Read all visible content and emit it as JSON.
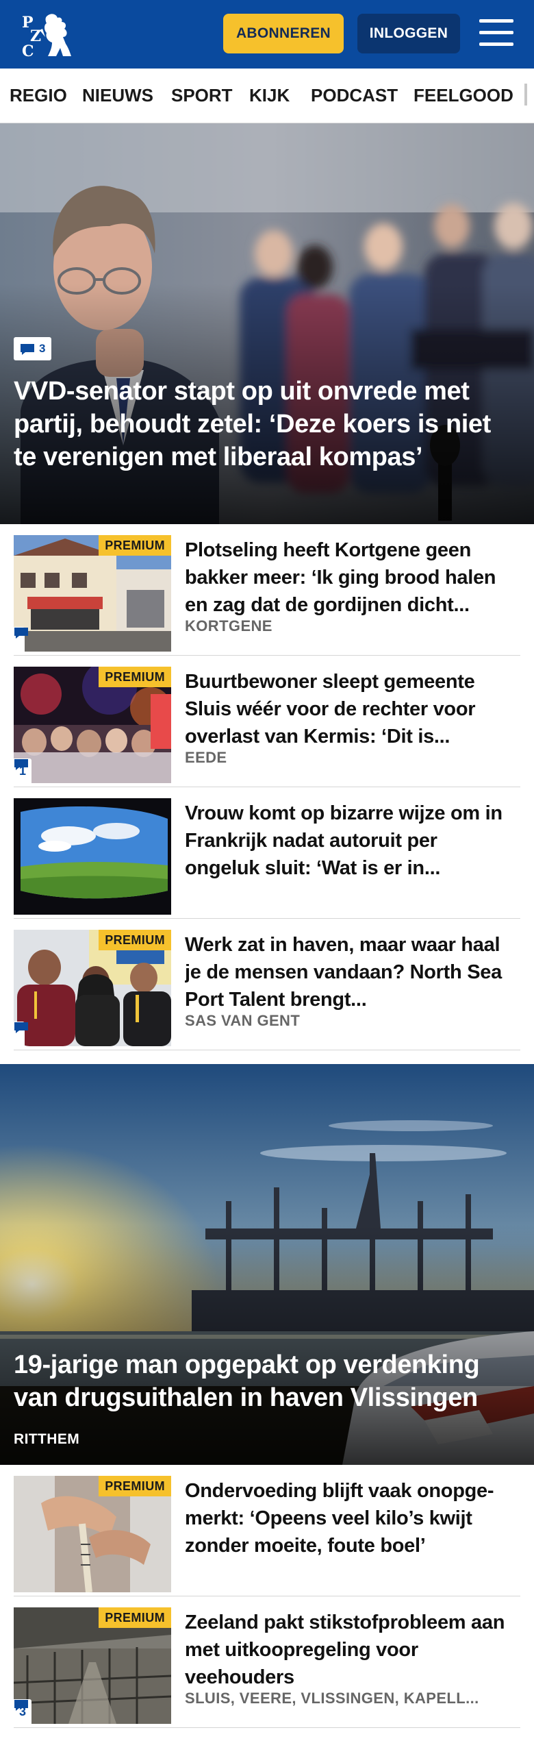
{
  "header": {
    "logo_text": "PZC",
    "subscribe_label": "ABONNEREN",
    "login_label": "INLOGGEN",
    "menu_icon": "hamburger-menu-icon",
    "brand_color": "#0a4a9e",
    "accent_color": "#f6c12c"
  },
  "nav": {
    "items": [
      "REGIO",
      "NIEUWS",
      "SPORT",
      "KIJK",
      "PODCAST",
      "FEELGOOD"
    ]
  },
  "hero1": {
    "comments": "3",
    "title": "VVD-senator stapt op uit onvrede met partij, behoudt zetel: ‘Deze koers is niet te verenigen met liberaal kompas’"
  },
  "articles": [
    {
      "premium": "PREMIUM",
      "title": "Plotseling heeft Kortgene geen bakker meer: ‘Ik ging brood halen en zag dat de gordijnen dicht...",
      "location": "KORTGENE",
      "comments": ""
    },
    {
      "premium": "PREMIUM",
      "title": "Buurtbewoner sleept gemeente Sluis wéér voor de rechter voor overlast van Kermis: ‘Dit is...",
      "location": "EEDE",
      "comments": "1"
    },
    {
      "premium": "",
      "title": "Vrouw komt op bizarre wijze om in Frankrijk nadat autoruit per ongeluk sluit: ‘Wat is er in...",
      "location": "",
      "comments": ""
    },
    {
      "premium": "PREMIUM",
      "title": "Werk zat in haven, maar waar haal je de mensen vandaan? North Sea Port Talent brengt...",
      "location": "SAS VAN GENT",
      "comments": ""
    }
  ],
  "hero2": {
    "title": "19-jarige man opgepakt op verdenking van drugsuithalen in haven Vlissingen",
    "location": "RITTHEM"
  },
  "articles2": [
    {
      "premium": "PREMIUM",
      "title": "Ondervoeding blijft vaak onopge-merkt: ‘Opeens veel kilo’s kwijt zonder moeite, foute boel’",
      "location": "",
      "comments": ""
    },
    {
      "premium": "PREMIUM",
      "title": "Zeeland pakt stikstofprobleem aan met uitkoopregeling voor veehouders",
      "location": "SLUIS, VEERE, VLISSINGEN, KAPELL...",
      "comments": "3"
    }
  ]
}
